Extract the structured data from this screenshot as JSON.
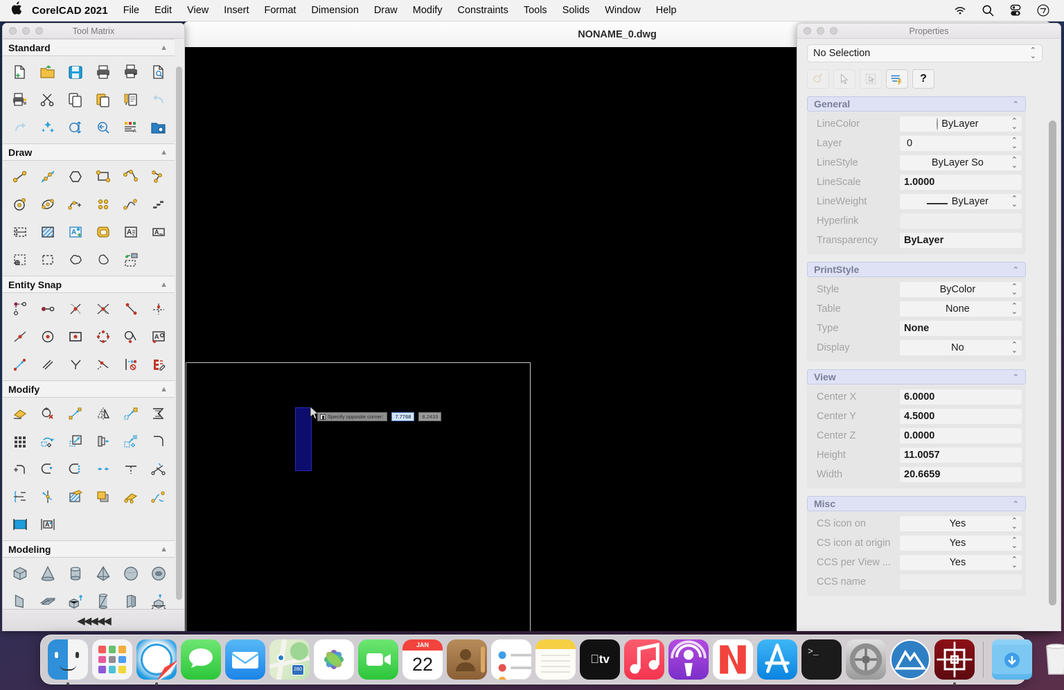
{
  "menubar": {
    "apple_icon": "apple-logo-icon",
    "app_name": "CorelCAD 2021",
    "items": [
      "File",
      "Edit",
      "View",
      "Insert",
      "Format",
      "Dimension",
      "Draw",
      "Modify",
      "Constraints",
      "Tools",
      "Solids",
      "Window",
      "Help"
    ],
    "status_icons": [
      "wifi-icon",
      "search-icon",
      "control-center-icon",
      "siri-icon"
    ]
  },
  "document": {
    "title": "NONAME_0.dwg",
    "canvas_background": "#000000",
    "dynamic_input": {
      "prompt": "Specify opposite corner:",
      "value_x": "7.7768",
      "value_y": "8.2433"
    }
  },
  "tool_matrix": {
    "title": "Tool Matrix",
    "footer_label": "◀◀◀◀◀",
    "sections": [
      {
        "name": "Standard",
        "collapse_caret": "▲",
        "tools": [
          "new-drawing-icon",
          "open-folder-icon",
          "save-icon",
          "print-icon",
          "print-preview-icon",
          "print-inspect-icon",
          "print-settings-icon",
          "cut-scissors-icon",
          "copy-icon",
          "paste-icon",
          "paste-special-icon",
          "undo-icon",
          "redo-icon",
          "cleanup-icon",
          "zoom-extents-icon",
          "zoom-previous-icon",
          "layers-manager-icon",
          "drawing-explorer-icon"
        ]
      },
      {
        "name": "Draw",
        "collapse_caret": "▲",
        "tools": [
          "line-icon",
          "infinite-line-icon",
          "polygon-icon",
          "rectangle-icon",
          "polyline-icon",
          "arc-polyline-icon",
          "circle-icon",
          "ellipse-icon",
          "arc-add-icon",
          "point-icon",
          "spline-icon",
          "ray-step-icon",
          "block-icon",
          "hatch-icon",
          "block-attribute-icon",
          "region-icon",
          "simple-note-icon",
          "note-icon",
          "boundary-icon",
          "revision-cloud-dash-icon",
          "cloud-icon",
          "freehand-cloud-icon",
          "import-region-icon"
        ]
      },
      {
        "name": "Entity Snap",
        "collapse_caret": "▲",
        "tools": [
          "snap-from-icon",
          "snap-endpoint-icon",
          "snap-midpoint-icon",
          "snap-intersection-icon",
          "snap-apparent-intersection-icon",
          "snap-perpendicular-icon",
          "snap-nearest-icon",
          "snap-center-icon",
          "snap-insertion-icon",
          "snap-quadrant-icon",
          "snap-tangent-icon",
          "snap-node-icon",
          "snap-parallel-icon",
          "snap-extension-icon",
          "snap-bisector-icon",
          "snap-point-on-entity-icon",
          "snap-none-icon",
          "snap-settings-icon"
        ]
      },
      {
        "name": "Modify",
        "collapse_caret": "▲",
        "tools": [
          "erase-icon",
          "delete-duplicate-icon",
          "move-icon",
          "mirror-icon",
          "copy-entity-icon",
          "offset-icon",
          "pattern-array-icon",
          "rotate-icon",
          "scale-icon",
          "stretch-icon",
          "align-icon",
          "fillet-icon",
          "chamfer-icon",
          "trim-icon",
          "extend-icon",
          "join-icon",
          "split-icon",
          "cut-entity-icon",
          "edit-polyline-icon",
          "edit-spline-icon",
          "edit-hatch-icon",
          "draw-order-icon",
          "explode-icon",
          "power-trim-icon",
          "clip-image-icon",
          "edit-text-icon"
        ]
      },
      {
        "name": "Modeling",
        "collapse_caret": "▲",
        "tools": [
          "box-solid-icon",
          "cone-solid-icon",
          "cylinder-solid-icon",
          "pyramid-solid-icon",
          "sphere-solid-icon",
          "torus-solid-icon",
          "wedge-solid-icon",
          "mesh-solid-icon",
          "extrude-icon",
          "revolve-icon",
          "sweep-icon",
          "loft-icon"
        ]
      }
    ]
  },
  "properties": {
    "title": "Properties",
    "selection": "No Selection",
    "toolbar_buttons": [
      "quick-select-icon",
      "pick-entity-icon",
      "pick-area-icon",
      "property-list-icon",
      "help-question-icon"
    ],
    "groups": [
      {
        "name": "General",
        "collapse_caret": "︿",
        "rows": [
          {
            "label": "LineColor",
            "value": "ByLayer",
            "kind": "combo-color"
          },
          {
            "label": "Layer",
            "value": "0",
            "kind": "combo"
          },
          {
            "label": "LineStyle",
            "value": "ByLayer      So",
            "kind": "combo"
          },
          {
            "label": "LineScale",
            "value": "1.0000",
            "kind": "text"
          },
          {
            "label": "LineWeight",
            "value": "ByLayer",
            "kind": "combo-weight"
          },
          {
            "label": "Hyperlink",
            "value": "",
            "kind": "blank"
          },
          {
            "label": "Transparency",
            "value": "ByLayer",
            "kind": "text"
          }
        ]
      },
      {
        "name": "PrintStyle",
        "collapse_caret": "︿",
        "rows": [
          {
            "label": "Style",
            "value": "ByColor",
            "kind": "combo"
          },
          {
            "label": "Table",
            "value": "None",
            "kind": "combo"
          },
          {
            "label": "Type",
            "value": "None",
            "kind": "text"
          },
          {
            "label": "Display",
            "value": "No",
            "kind": "combo"
          }
        ]
      },
      {
        "name": "View",
        "collapse_caret": "︿",
        "rows": [
          {
            "label": "Center X",
            "value": "6.0000",
            "kind": "text"
          },
          {
            "label": "Center Y",
            "value": "4.5000",
            "kind": "text"
          },
          {
            "label": "Center Z",
            "value": "0.0000",
            "kind": "text"
          },
          {
            "label": "Height",
            "value": "11.0057",
            "kind": "text"
          },
          {
            "label": "Width",
            "value": "20.6659",
            "kind": "text"
          }
        ]
      },
      {
        "name": "Misc",
        "collapse_caret": "︿",
        "rows": [
          {
            "label": "CS icon on",
            "value": "Yes",
            "kind": "combo"
          },
          {
            "label": "CS icon at origin",
            "value": "Yes",
            "kind": "combo"
          },
          {
            "label": "CCS per View ...",
            "value": "Yes",
            "kind": "combo"
          },
          {
            "label": "CCS name",
            "value": "",
            "kind": "blank"
          }
        ]
      }
    ]
  },
  "dock": {
    "items": [
      {
        "name": "finder",
        "running": true
      },
      {
        "name": "launchpad",
        "running": false
      },
      {
        "name": "safari",
        "running": true
      },
      {
        "name": "messages",
        "running": false
      },
      {
        "name": "mail",
        "running": false
      },
      {
        "name": "maps",
        "running": false
      },
      {
        "name": "photos",
        "running": false
      },
      {
        "name": "facetime",
        "running": false
      },
      {
        "name": "calendar",
        "running": false,
        "month": "JAN",
        "day": "22"
      },
      {
        "name": "contacts",
        "running": false
      },
      {
        "name": "reminders",
        "running": false
      },
      {
        "name": "notes",
        "running": false
      },
      {
        "name": "apple-tv",
        "running": false
      },
      {
        "name": "music",
        "running": false
      },
      {
        "name": "podcasts",
        "running": false
      },
      {
        "name": "news",
        "running": false
      },
      {
        "name": "app-store",
        "running": false
      },
      {
        "name": "terminal",
        "running": false
      },
      {
        "name": "system-preferences",
        "running": false
      },
      {
        "name": "corel-app",
        "running": false
      },
      {
        "name": "corelcad",
        "running": true
      },
      {
        "name": "downloads-folder",
        "running": false
      },
      {
        "name": "trash",
        "running": false
      }
    ]
  }
}
